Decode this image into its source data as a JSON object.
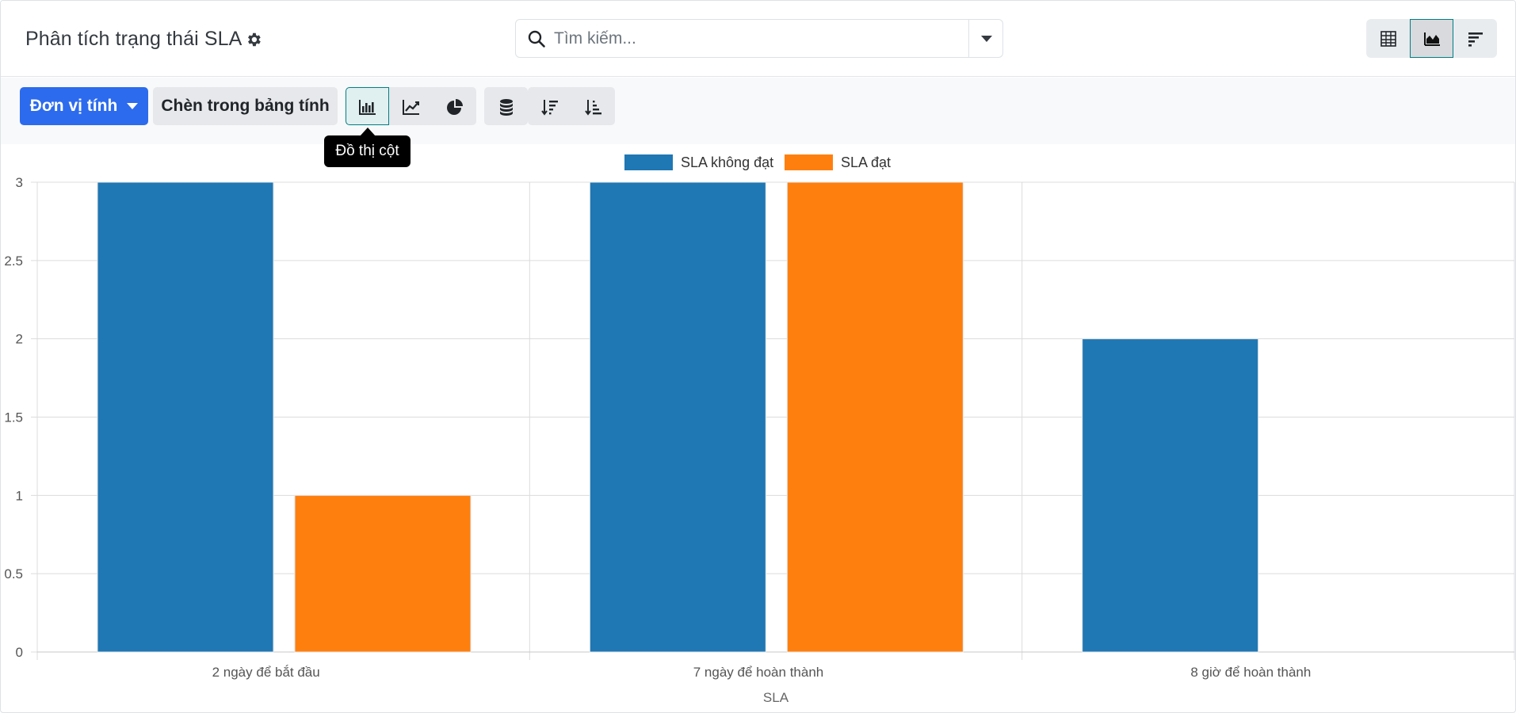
{
  "header": {
    "title": "Phân tích trạng thái SLA",
    "search_placeholder": "Tìm kiếm..."
  },
  "view_switcher": {
    "items": [
      {
        "name": "pivot",
        "icon": "table-icon",
        "active": false
      },
      {
        "name": "graph",
        "icon": "area-chart-icon",
        "active": true
      },
      {
        "name": "cohort",
        "icon": "bar-list-icon",
        "active": false
      }
    ]
  },
  "toolbar": {
    "measure_label": "Đơn vị tính",
    "insert_label": "Chèn trong bảng tính",
    "chart_types": [
      {
        "icon": "bar-chart-icon",
        "active": true
      },
      {
        "icon": "line-chart-icon",
        "active": false
      },
      {
        "icon": "pie-chart-icon",
        "active": false
      }
    ],
    "stacked_icon": "database-icon",
    "sort_icons": [
      "sort-descending-icon",
      "sort-ascending-icon"
    ],
    "tooltip": "Đồ thị cột"
  },
  "chart_data": {
    "type": "bar",
    "categories": [
      "2 ngày để bắt đầu",
      "7 ngày để hoàn thành",
      "8 giờ để hoàn thành"
    ],
    "series": [
      {
        "name": "SLA không đạt",
        "values": [
          3,
          3,
          2
        ],
        "color": "#1f77b4"
      },
      {
        "name": "SLA đạt",
        "values": [
          1,
          3,
          0
        ],
        "color": "#ff7f0e"
      }
    ],
    "xlabel": "SLA",
    "ylabel": "",
    "ylim": [
      0,
      3
    ],
    "yticks": [
      "0",
      "0.5",
      "1",
      "1.5",
      "2",
      "2.5",
      "3"
    ],
    "grid": true,
    "legend": "top-center"
  }
}
